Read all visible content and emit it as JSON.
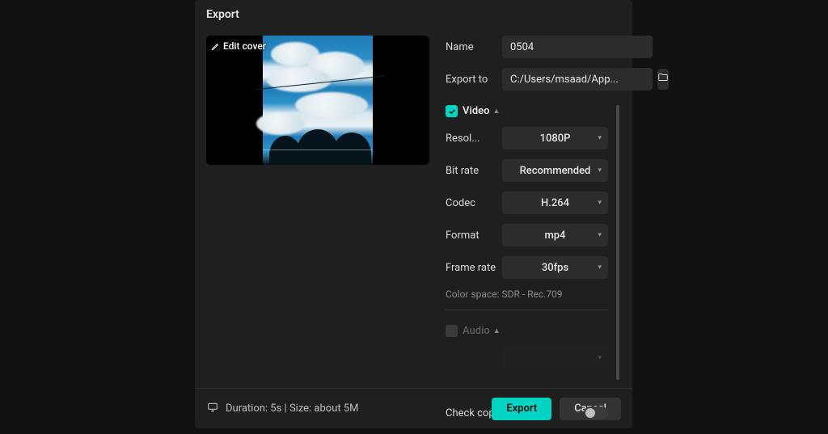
{
  "title": "Export",
  "preview": {
    "edit_cover_label": "Edit cover"
  },
  "fields": {
    "name_label": "Name",
    "name_value": "0504",
    "export_to_label": "Export to",
    "export_to_value": "C:/Users/msaad/App..."
  },
  "video": {
    "section_label": "Video",
    "checked": true,
    "resolution_label": "Resol...",
    "resolution_value": "1080P",
    "bitrate_label": "Bit rate",
    "bitrate_value": "Recommended",
    "codec_label": "Codec",
    "codec_value": "H.264",
    "format_label": "Format",
    "format_value": "mp4",
    "framerate_label": "Frame rate",
    "framerate_value": "30fps",
    "color_space_info": "Color space: SDR - Rec.709"
  },
  "audio": {
    "section_label": "Audio"
  },
  "copyright": {
    "label": "Check copyright?"
  },
  "footer": {
    "info": "Duration: 5s | Size: about 5M",
    "export_label": "Export",
    "cancel_label": "Cancel"
  }
}
